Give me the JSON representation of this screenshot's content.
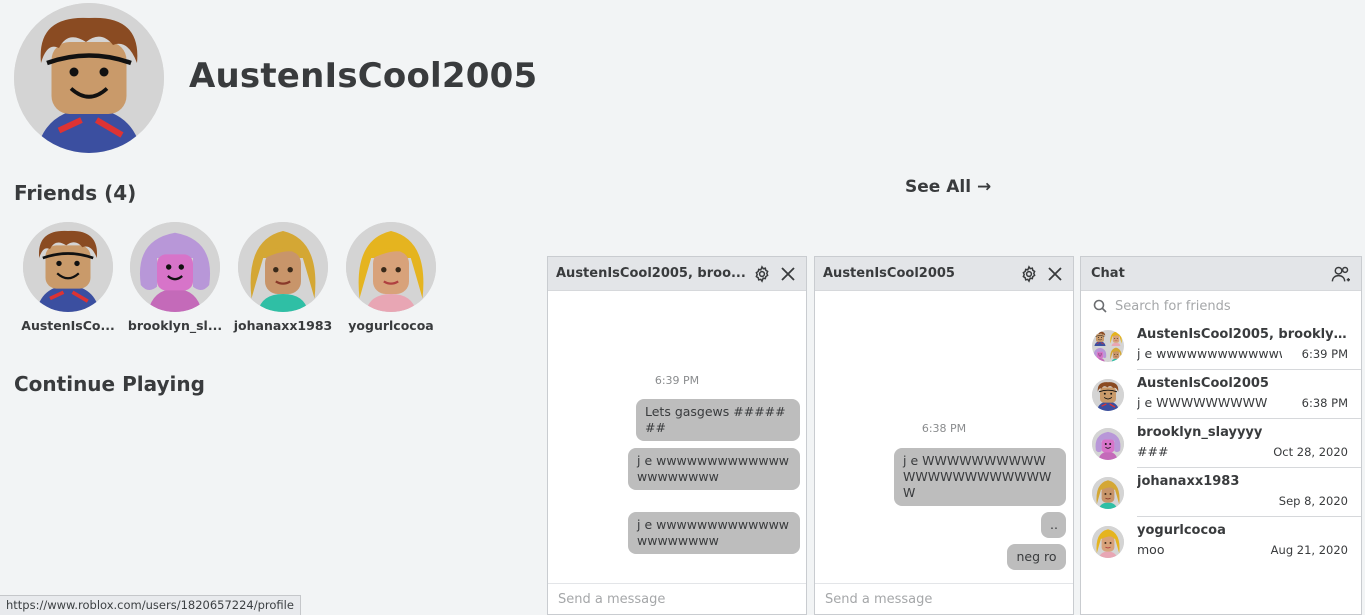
{
  "profile": {
    "username": "AustenIsCool2005"
  },
  "friends": {
    "title": "Friends (4)",
    "see_all": "See All →",
    "items": [
      {
        "name": "AustenIsCo...",
        "avatar": "brown-hair-avatar"
      },
      {
        "name": "brooklyn_sl...",
        "avatar": "purple-hair-avatar"
      },
      {
        "name": "johanaxx1983",
        "avatar": "blonde-avatar-teal"
      },
      {
        "name": "yogurlcocoa",
        "avatar": "blonde-avatar-pink"
      }
    ]
  },
  "continue_playing": {
    "title": "Continue Playing"
  },
  "chat_windows": [
    {
      "title": "AustenIsCool2005, broo...",
      "timestamp": "6:39 PM",
      "messages": [
        "Lets gasgews #######",
        "j e wwwwwwwwwwwwwwwwwwwww",
        "j e wwwwwwwwwwwwwwwwwwwww"
      ],
      "input_placeholder": "Send a message"
    },
    {
      "title": "AustenIsCool2005",
      "timestamp": "6:38 PM",
      "messages": [
        "j e WWWWWWWWWWWWWWWWWWWWWWW",
        "..",
        "neg ro"
      ],
      "input_placeholder": "Send a message"
    }
  ],
  "chat_panel": {
    "title": "Chat",
    "search_placeholder": "Search for friends",
    "conversations": [
      {
        "name": "AustenIsCool2005, brooklyn_sl...",
        "message": "j e wwwwwwwwwwwwwv",
        "time": "6:39 PM"
      },
      {
        "name": "AustenIsCool2005",
        "message": "j e WWWWWWWWW",
        "time": "6:38 PM"
      },
      {
        "name": "brooklyn_slayyyy",
        "message": "###",
        "time": "Oct 28, 2020"
      },
      {
        "name": "johanaxx1983",
        "message": "",
        "time": "Sep 8, 2020"
      },
      {
        "name": "yogurlcocoa",
        "message": "moo",
        "time": "Aug 21, 2020"
      }
    ]
  },
  "status_bar": {
    "url": "https://www.roblox.com/users/1820657224/profile"
  },
  "colors": {
    "background": "#f2f4f5",
    "text": "#393b3d",
    "bubble": "#bdbdbd",
    "header": "#e3e5e8"
  }
}
